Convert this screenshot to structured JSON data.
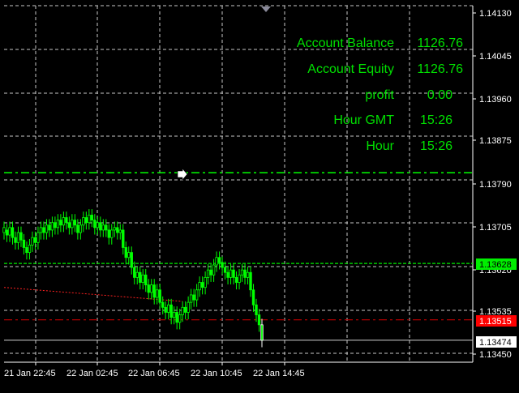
{
  "info_panel": {
    "rows": [
      {
        "label": "Account Balance",
        "value": "1126.76"
      },
      {
        "label": "Account Equity",
        "value": "1126.76"
      },
      {
        "label": "profit",
        "value": "0.00"
      },
      {
        "label": "Hour GMT",
        "value": "15:26"
      },
      {
        "label": "Hour",
        "value": "15:26"
      }
    ]
  },
  "price_axis": {
    "labels": [
      "1.14130",
      "1.14045",
      "1.13960",
      "1.13875",
      "1.13790",
      "1.13705",
      "1.13620",
      "1.13535",
      "1.13450"
    ]
  },
  "time_axis": {
    "labels": [
      "21 Jan 22:45",
      "22 Jan 02:45",
      "22 Jan 06:45",
      "22 Jan 10:45",
      "22 Jan 14:45"
    ]
  },
  "price_tags": {
    "green_line": {
      "label": "1.13628",
      "price": 1.13628
    },
    "red_line": {
      "label": "1.13515",
      "price": 1.13515
    },
    "white_line": {
      "label": "1.13474",
      "price": 1.13474
    }
  },
  "levels": {
    "upper_dashed_green": 1.1381,
    "red_dotted_start": 1.1358,
    "red_dotted_end": 1.13552
  },
  "colors": {
    "background": "#000000",
    "grid": "#c8c8c8",
    "candles": "#00ff00",
    "green_tag": "#00ee00",
    "red_tag": "#ff0000",
    "white_tag": "#ffffff",
    "text": "#00e000"
  },
  "chart_data": {
    "type": "candlestick",
    "symbol_unit": "price",
    "ylim": [
      1.1343,
      1.14145
    ],
    "candles": [
      [
        1.1369,
        1.137
      ],
      [
        1.13695,
        1.13685
      ],
      [
        1.13685,
        1.137
      ],
      [
        1.137,
        1.1368
      ],
      [
        1.1368,
        1.1367
      ],
      [
        1.1367,
        1.1369
      ],
      [
        1.1369,
        1.13675
      ],
      [
        1.13675,
        1.1366
      ],
      [
        1.1366,
        1.1365
      ],
      [
        1.1365,
        1.13665
      ],
      [
        1.13665,
        1.1368
      ],
      [
        1.1368,
        1.1367
      ],
      [
        1.1367,
        1.1369
      ],
      [
        1.1369,
        1.137
      ],
      [
        1.137,
        1.1369
      ],
      [
        1.1369,
        1.13705
      ],
      [
        1.13705,
        1.13695
      ],
      [
        1.13695,
        1.1371
      ],
      [
        1.1371,
        1.137
      ],
      [
        1.137,
        1.13715
      ],
      [
        1.13715,
        1.13705
      ],
      [
        1.13705,
        1.1372
      ],
      [
        1.1372,
        1.1371
      ],
      [
        1.1371,
        1.137
      ],
      [
        1.137,
        1.13715
      ],
      [
        1.13715,
        1.13705
      ],
      [
        1.13705,
        1.1369
      ],
      [
        1.1369,
        1.13705
      ],
      [
        1.13705,
        1.1372
      ],
      [
        1.1372,
        1.1371
      ],
      [
        1.1371,
        1.13725
      ],
      [
        1.13725,
        1.13715
      ],
      [
        1.13715,
        1.137
      ],
      [
        1.137,
        1.1371
      ],
      [
        1.1371,
        1.13695
      ],
      [
        1.13695,
        1.13705
      ],
      [
        1.13705,
        1.13695
      ],
      [
        1.13695,
        1.1368
      ],
      [
        1.1368,
        1.13695
      ],
      [
        1.13695,
        1.137
      ],
      [
        1.137,
        1.1369
      ],
      [
        1.1369,
        1.13695
      ],
      [
        1.13695,
        1.1366
      ],
      [
        1.1366,
        1.1364
      ],
      [
        1.1364,
        1.1365
      ],
      [
        1.1365,
        1.1362
      ],
      [
        1.1362,
        1.136
      ],
      [
        1.136,
        1.1361
      ],
      [
        1.1361,
        1.1359
      ],
      [
        1.1359,
        1.13605
      ],
      [
        1.13605,
        1.13585
      ],
      [
        1.13585,
        1.1357
      ],
      [
        1.1357,
        1.13585
      ],
      [
        1.13585,
        1.1356
      ],
      [
        1.1356,
        1.13575
      ],
      [
        1.13575,
        1.1355
      ],
      [
        1.1355,
        1.1354
      ],
      [
        1.1354,
        1.1353
      ],
      [
        1.1353,
        1.13545
      ],
      [
        1.13545,
        1.1352
      ],
      [
        1.1352,
        1.1353
      ],
      [
        1.1353,
        1.1351
      ],
      [
        1.1351,
        1.13525
      ],
      [
        1.13525,
        1.1354
      ],
      [
        1.1354,
        1.1353
      ],
      [
        1.1353,
        1.1355
      ],
      [
        1.1355,
        1.13565
      ],
      [
        1.13565,
        1.13555
      ],
      [
        1.13555,
        1.13575
      ],
      [
        1.13575,
        1.1359
      ],
      [
        1.1359,
        1.1358
      ],
      [
        1.1358,
        1.136
      ],
      [
        1.136,
        1.13615
      ],
      [
        1.13615,
        1.13605
      ],
      [
        1.13605,
        1.13625
      ],
      [
        1.13625,
        1.1364
      ],
      [
        1.1364,
        1.1363
      ],
      [
        1.1363,
        1.1362
      ],
      [
        1.1362,
        1.1361
      ],
      [
        1.1361,
        1.136
      ],
      [
        1.136,
        1.13615
      ],
      [
        1.13615,
        1.136
      ],
      [
        1.136,
        1.1359
      ],
      [
        1.1359,
        1.13605
      ],
      [
        1.13605,
        1.13615
      ],
      [
        1.13615,
        1.136
      ],
      [
        1.136,
        1.1361
      ],
      [
        1.1361,
        1.13575
      ],
      [
        1.13575,
        1.13545
      ],
      [
        1.13545,
        1.13525
      ],
      [
        1.13525,
        1.13505
      ],
      [
        1.13505,
        1.13474
      ]
    ]
  }
}
